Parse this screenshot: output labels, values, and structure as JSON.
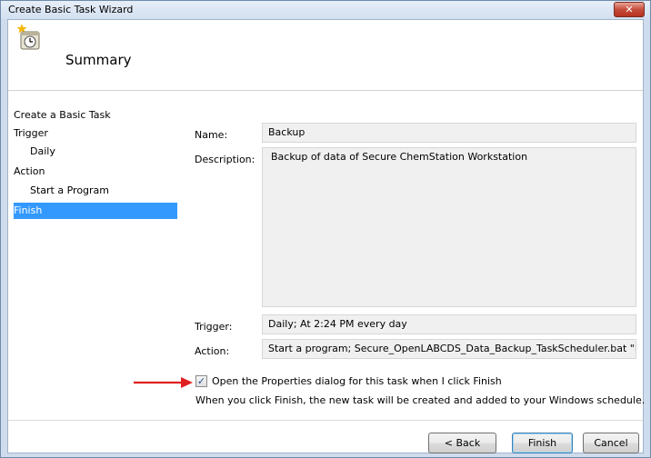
{
  "window": {
    "title": "Create Basic Task Wizard",
    "close_glyph": "✕"
  },
  "header": {
    "title": "Summary",
    "icon": "task-scheduler-icon"
  },
  "steps": [
    {
      "label": "Create a Basic Task",
      "selected": false
    },
    {
      "label": "Trigger",
      "selected": false
    },
    {
      "label": "Daily",
      "selected": false
    },
    {
      "label": "Action",
      "selected": false
    },
    {
      "label": "Start a Program",
      "selected": false
    },
    {
      "label": "Finish",
      "selected": true
    }
  ],
  "summary": {
    "name_label": "Name:",
    "name_value": "Backup",
    "description_label": "Description:",
    "description_value": "Backup of data of Secure ChemStation Workstation",
    "trigger_label": "Trigger:",
    "trigger_value": "Daily; At 2:24 PM every day",
    "action_label": "Action:",
    "action_value": "Start a program; Secure_OpenLABCDS_Data_Backup_TaskScheduler.bat \"E:\\B"
  },
  "options": {
    "open_properties_label": "Open the Properties dialog for this task when I click Finish",
    "open_properties_checked": true,
    "check_glyph": "✓",
    "info_text": "When you click Finish, the new task will be created and added to your Windows schedule."
  },
  "buttons": {
    "back": "< Back",
    "finish": "Finish",
    "cancel": "Cancel"
  },
  "colors": {
    "selection": "#3399ff",
    "annotation_arrow": "#e02020"
  }
}
